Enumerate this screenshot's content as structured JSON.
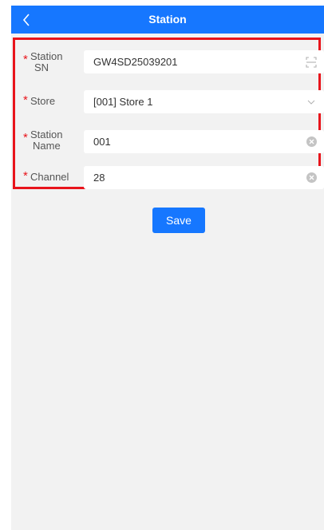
{
  "header": {
    "title": "Station",
    "back_icon": "chevron-left-icon"
  },
  "form": {
    "required_marker": "*",
    "station_sn": {
      "label_line1": "Station",
      "label_line2": "SN",
      "value": "GW4SD25039201",
      "icon": "scan-icon"
    },
    "store": {
      "label": "Store",
      "value": "[001] Store 1",
      "icon": "chevron-down-icon"
    },
    "station_name": {
      "label_line1": "Station",
      "label_line2": "Name",
      "value": "001",
      "icon": "clear-icon"
    },
    "channel": {
      "label": "Channel",
      "value": "28",
      "icon": "clear-icon"
    }
  },
  "actions": {
    "save_label": "Save"
  },
  "colors": {
    "primary": "#1677ff",
    "required": "#e8141b",
    "highlight_border": "#e8141b",
    "background": "#f2f2f2"
  }
}
